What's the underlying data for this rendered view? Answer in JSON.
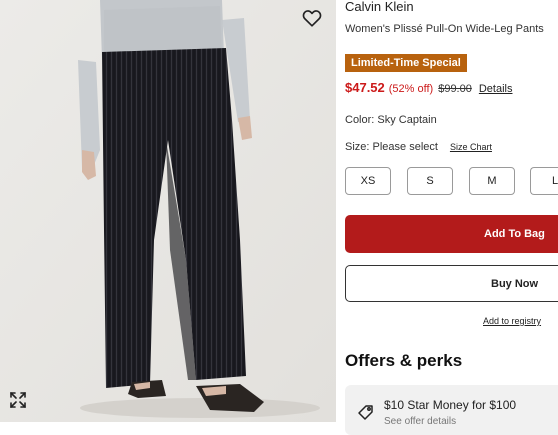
{
  "product": {
    "brand": "Calvin Klein",
    "name": "Women's Plissé Pull-On Wide-Leg Pants",
    "promo_badge": "Limited-Time Special",
    "price": {
      "sale": "$47.52",
      "percent_off": "(52% off)",
      "original": "$99.00",
      "details_link": "Details"
    },
    "color": "Color: Sky Captain",
    "size_label": "Size: Please select",
    "size_chart_link": "Size Chart",
    "sizes": [
      "XS",
      "S",
      "M",
      "L"
    ]
  },
  "actions": {
    "add_to_bag": "Add To Bag",
    "buy_now": "Buy Now",
    "add_to_registry": "Add to registry"
  },
  "offers": {
    "heading": "Offers & perks",
    "card_title": "$10 Star Money for $100",
    "card_subtitle": "See offer details"
  },
  "icons": {
    "wishlist": "heart-icon",
    "expand": "expand-icon",
    "offer": "tag-icon"
  },
  "colors": {
    "promo_badge_bg": "#b8620e",
    "sale_price": "#cc1a1a",
    "add_to_bag_bg": "#b31b1b"
  }
}
